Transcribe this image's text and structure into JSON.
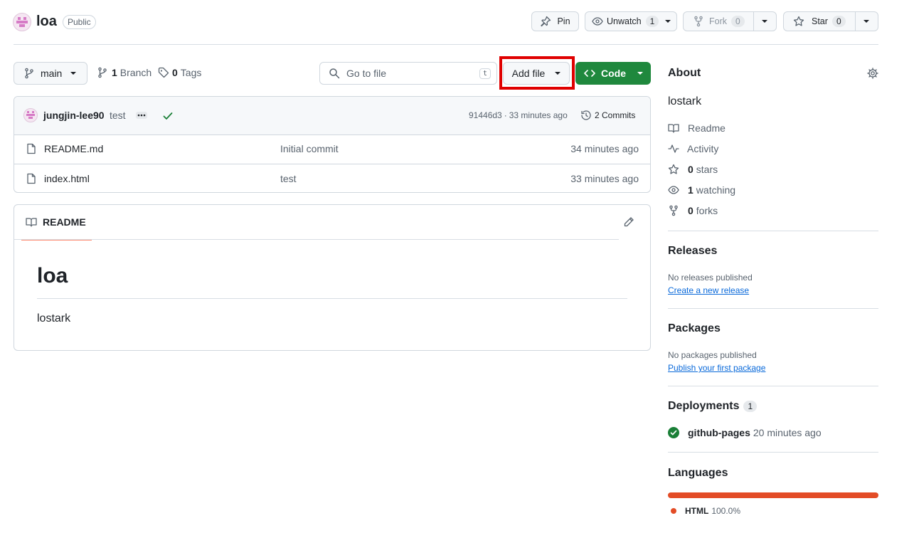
{
  "repo": {
    "name": "loa",
    "visibility": "Public",
    "pin_label": "Pin",
    "unwatch_label": "Unwatch",
    "watch_count": "1",
    "fork_label": "Fork",
    "fork_count": "0",
    "star_label": "Star",
    "star_count": "0"
  },
  "toolbar": {
    "branch": "main",
    "branch_count": "1",
    "branch_label": "Branch",
    "tag_count": "0",
    "tag_label": "Tags",
    "search_placeholder": "Go to file",
    "search_shortcut": "t",
    "add_file_label": "Add file",
    "code_label": "Code"
  },
  "commit": {
    "author": "jungjin-lee90",
    "message": "test",
    "hash": "91446d3",
    "separator": "·",
    "time": "33 minutes ago",
    "commits_label": "2 Commits"
  },
  "files": [
    {
      "name": "README.md",
      "message": "Initial commit",
      "time": "34 minutes ago"
    },
    {
      "name": "index.html",
      "message": "test",
      "time": "33 minutes ago"
    }
  ],
  "readme": {
    "tab_label": "README",
    "heading": "loa",
    "body": "lostark"
  },
  "about": {
    "title": "About",
    "description": "lostark",
    "readme_label": "Readme",
    "activity_label": "Activity",
    "stars_count": "0",
    "stars_label": "stars",
    "watching_count": "1",
    "watching_label": "watching",
    "forks_count": "0",
    "forks_label": "forks"
  },
  "releases": {
    "title": "Releases",
    "empty_text": "No releases published",
    "create_link": "Create a new release"
  },
  "packages": {
    "title": "Packages",
    "empty_text": "No packages published",
    "publish_link": "Publish your first package"
  },
  "deployments": {
    "title": "Deployments",
    "count": "1",
    "env": "github-pages",
    "time": "20 minutes ago"
  },
  "languages": {
    "title": "Languages",
    "items": [
      {
        "name": "HTML",
        "percent": "100.0%",
        "fraction": 1.0,
        "color": "#e34c26"
      }
    ]
  },
  "colors": {
    "highlight": "#e00000",
    "primary_button": "#1f883d",
    "link": "#0969da",
    "success": "#1a7f37"
  },
  "icons": [
    "identicon-avatar",
    "pin-icon",
    "eye-icon",
    "fork-icon",
    "star-icon",
    "branch-icon",
    "tag-icon",
    "search-icon",
    "code-icon",
    "ellipsis-icon",
    "check-icon",
    "history-icon",
    "file-icon",
    "book-icon",
    "pencil-icon",
    "gear-icon",
    "pulse-icon",
    "check-circle-icon"
  ]
}
